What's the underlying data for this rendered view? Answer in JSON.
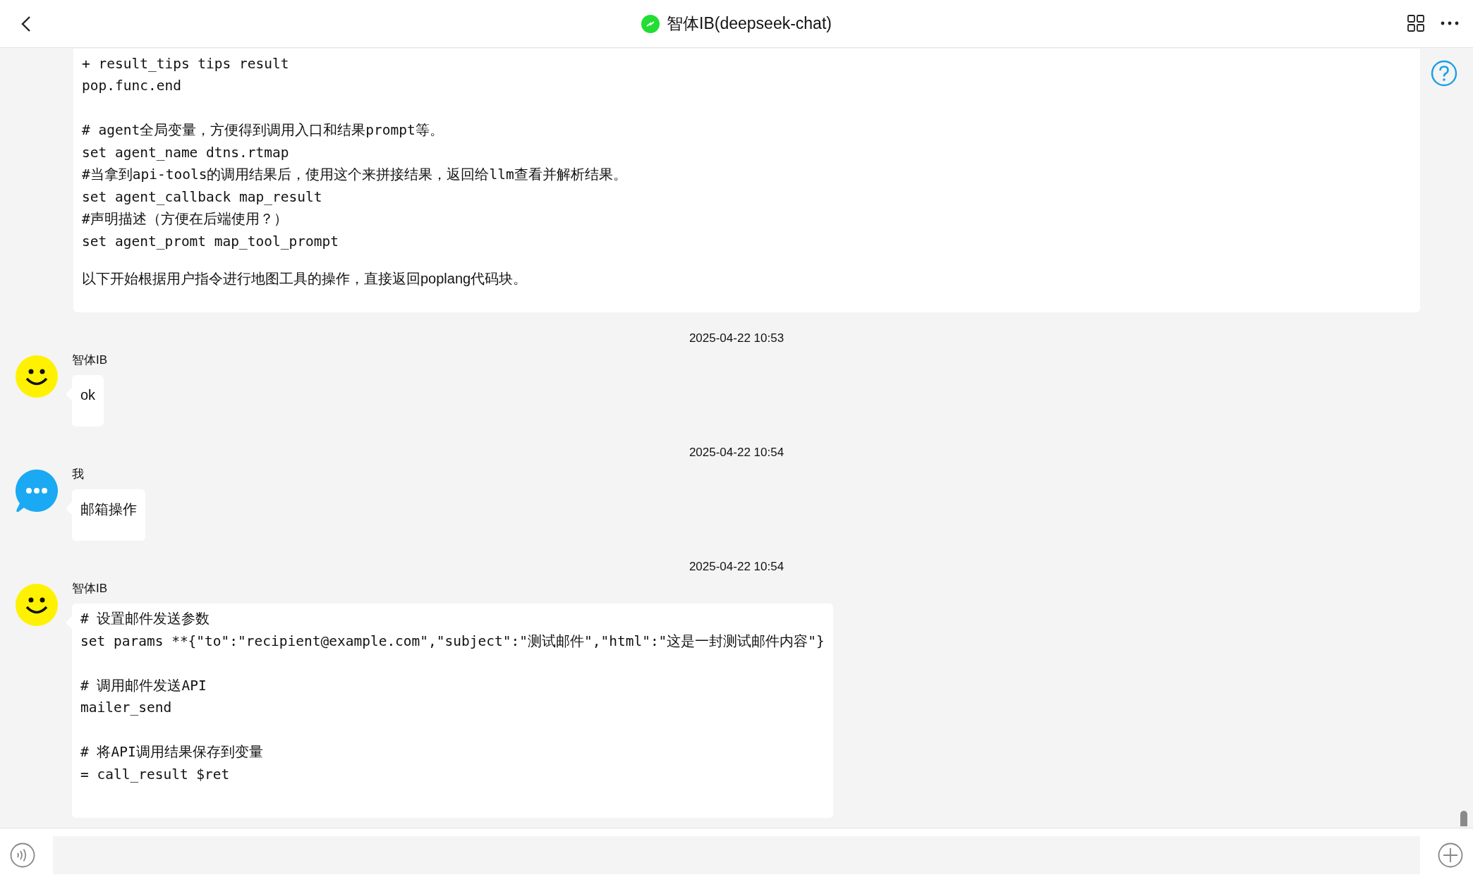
{
  "header": {
    "title": "智体IB(deepseek-chat)",
    "online": true
  },
  "messages": [
    {
      "kind": "continued",
      "blocks": [
        {
          "kind": "code",
          "text": "+ result_tips tips result\npop.func.end\n\n# agent全局变量，方便得到调用入口和结果prompt等。\nset agent_name dtns.rtmap\n#当拿到api-tools的调用结果后，使用这个来拼接结果，返回给llm查看并解析结果。\nset agent_callback map_result\n#声明描述（方便在后端使用？）\nset agent_promt map_tool_prompt"
        },
        {
          "kind": "text",
          "text": "以下开始根据用户指令进行地图工具的操作，直接返回poplang代码块。"
        }
      ]
    },
    {
      "kind": "bot",
      "time": "2025-04-22 10:53",
      "sender": "智体IB",
      "blocks": [
        {
          "kind": "text",
          "text": "ok"
        }
      ]
    },
    {
      "kind": "user",
      "time": "2025-04-22 10:54",
      "sender": "我",
      "blocks": [
        {
          "kind": "text",
          "text": "邮箱操作"
        }
      ]
    },
    {
      "kind": "bot",
      "time": "2025-04-22 10:54",
      "sender": "智体IB",
      "blocks": [
        {
          "kind": "code",
          "text": "# 设置邮件发送参数\nset params **{\"to\":\"recipient@example.com\",\"subject\":\"测试邮件\",\"html\":\"这是一封测试邮件内容\"}\n\n# 调用邮件发送API\nmailer_send\n\n# 将API调用结果保存到变量\n= call_result $ret"
        }
      ]
    }
  ]
}
